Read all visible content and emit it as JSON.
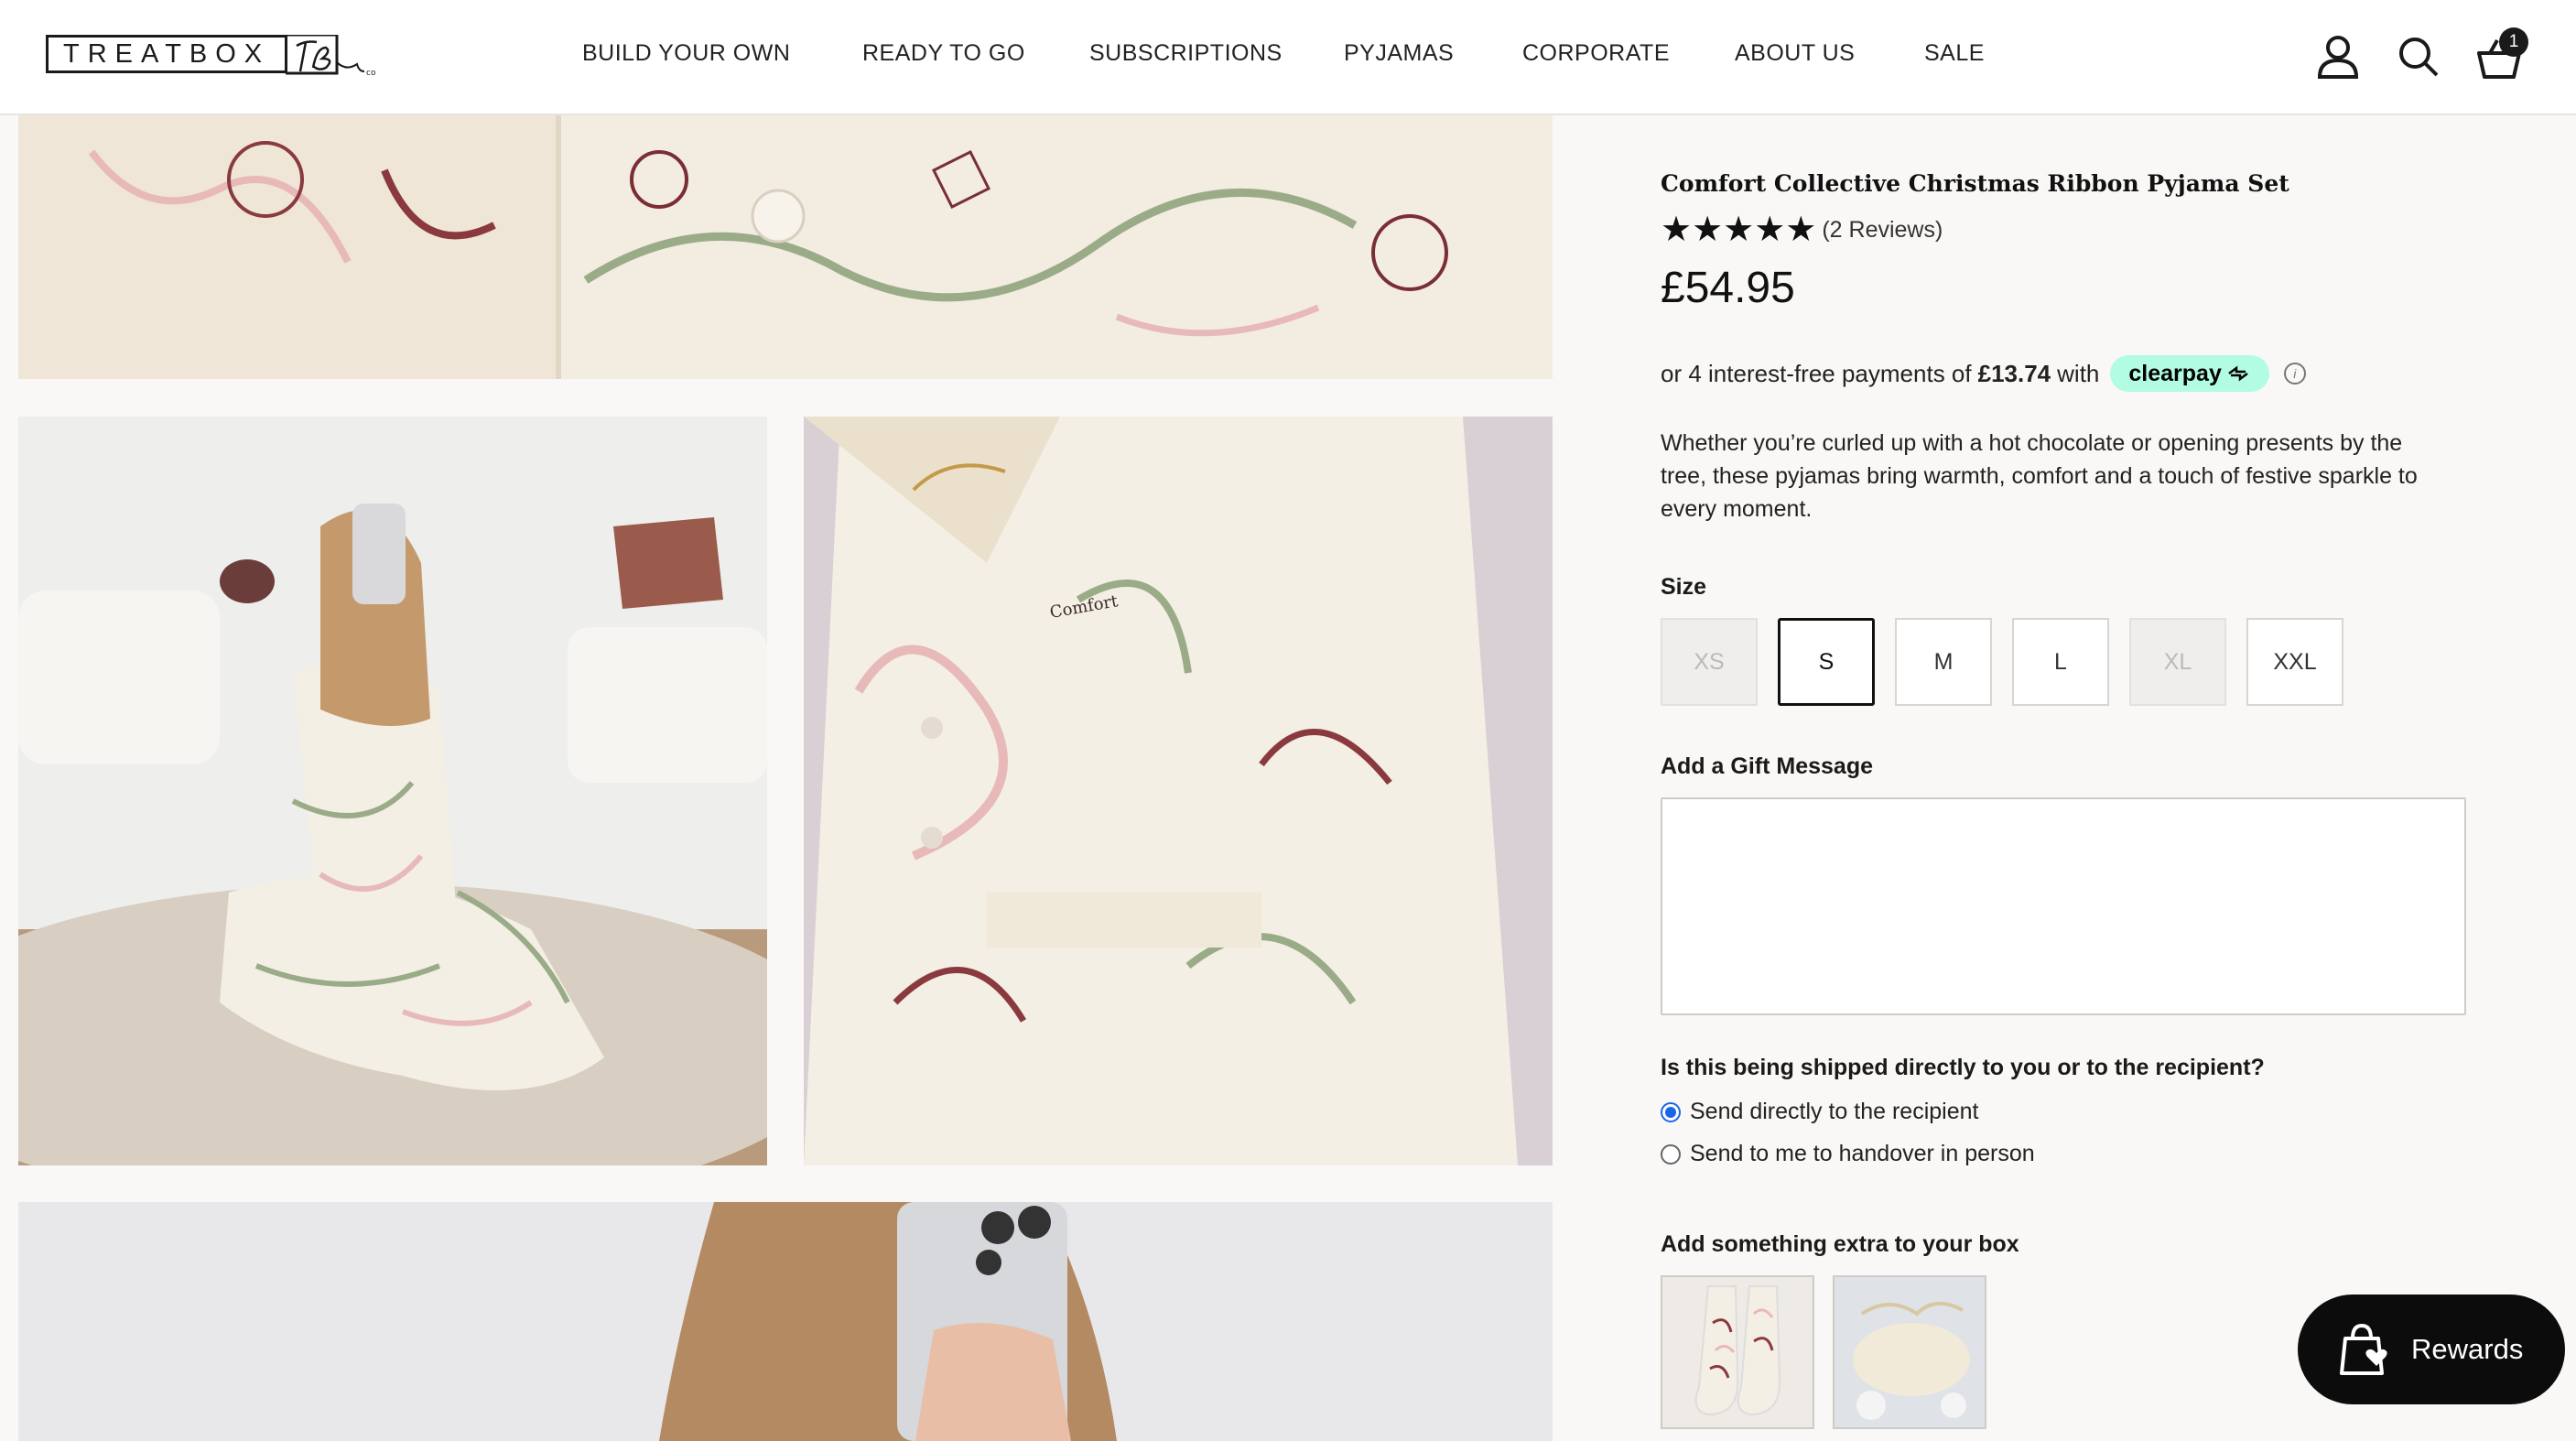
{
  "header": {
    "logo_text": "TREATBOX",
    "nav": [
      "BUILD YOUR OWN",
      "READY TO GO",
      "SUBSCRIPTIONS",
      "PYJAMAS",
      "CORPORATE",
      "ABOUT US",
      "SALE"
    ],
    "cart_count": "1"
  },
  "product": {
    "title": "Comfort Collective Christmas Ribbon Pyjama Set",
    "rating_stars": "★★★★★",
    "reviews": "(2 Reviews)",
    "price": "£54.95",
    "clearpay_prefix": "or 4 interest-free payments of",
    "clearpay_amount": "£13.74",
    "clearpay_with": "with",
    "clearpay_brand": "clearpay",
    "info_symbol": "i",
    "description": "Whether you’re curled up with a hot chocolate or opening presents by the tree, these pyjamas bring warmth, comfort and a touch of festive sparkle to every moment.",
    "size_label": "Size",
    "sizes": [
      {
        "label": "XS",
        "state": "unavailable"
      },
      {
        "label": "S",
        "state": "selected"
      },
      {
        "label": "M",
        "state": "available"
      },
      {
        "label": "L",
        "state": "available"
      },
      {
        "label": "XL",
        "state": "unavailable"
      },
      {
        "label": "XXL",
        "state": "available"
      }
    ],
    "gift_label": "Add a Gift Message",
    "gift_value": "",
    "shipping_question": "Is this being shipped directly to you or to the recipient?",
    "shipping_options": [
      {
        "label": "Send directly to the recipient",
        "checked": true
      },
      {
        "label": "Send to me to handover in person",
        "checked": false
      }
    ],
    "extras_label": "Add something extra to your box"
  },
  "rewards": {
    "label": "Rewards"
  },
  "colors": {
    "accent_radio": "#1a66e8",
    "clearpay_mint": "#b2fce4",
    "rewards_bg": "#0c0c0c"
  }
}
